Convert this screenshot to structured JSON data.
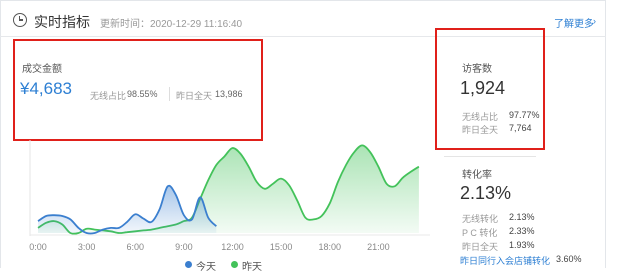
{
  "header": {
    "title": "实时指标",
    "update_time": "更新时间：2020-12-29 11:16:40",
    "more_link": "了解更多"
  },
  "sales": {
    "label": "成交金额",
    "value": "¥4,683",
    "wireless_label": "无线占比",
    "wireless_value": "98.55%",
    "yesterday_label": "昨日全天",
    "yesterday_value": "13,986"
  },
  "visitors": {
    "label": "访客数",
    "value": "1,924",
    "wireless_label": "无线占比",
    "wireless_value": "97.77%",
    "yesterday_label": "昨日全天",
    "yesterday_value": "7,764"
  },
  "conversion": {
    "label": "转化率",
    "value": "2.13%",
    "wireless_label": "无线转化",
    "wireless_value": "2.13%",
    "pc_label": "P C 转化",
    "pc_value": "2.33%",
    "yesterday_label": "昨日全天",
    "yesterday_value": "1.93%",
    "peer_label": "昨日同行入会店铺转化",
    "peer_value": "3.60%"
  },
  "colors": {
    "accent": "#2d7fd3",
    "highlight_box": "#e0201a",
    "today_line": "#3b7fcf",
    "yesterday_line": "#43c25a"
  },
  "chart_data": {
    "type": "area",
    "x_ticks": [
      "0:00",
      "3:00",
      "6:00",
      "9:00",
      "12:00",
      "15:00",
      "18:00",
      "21:00"
    ],
    "xlim": [
      0,
      24
    ],
    "y_axis_visible": false,
    "legend_position": "bottom-center",
    "series": [
      {
        "name": "今天",
        "color": "#3b7fcf",
        "x": [
          0,
          0.5,
          1,
          1.5,
          2,
          2.5,
          3,
          3.5,
          4,
          4.5,
          5,
          5.5,
          6,
          6.5,
          7,
          7.5,
          8,
          8.5,
          9,
          9.5,
          10,
          10.5,
          11
        ],
        "values": [
          0.14,
          0.2,
          0.21,
          0.2,
          0.16,
          0.06,
          0.0,
          0.0,
          0.04,
          0.06,
          0.06,
          0.13,
          0.22,
          0.17,
          0.13,
          0.28,
          0.55,
          0.45,
          0.21,
          0.16,
          0.42,
          0.18,
          0.08
        ]
      },
      {
        "name": "昨天",
        "color": "#43c25a",
        "x": [
          0,
          0.5,
          1,
          1.5,
          2,
          2.5,
          3,
          3.5,
          4,
          4.5,
          5,
          5.5,
          6,
          6.5,
          7,
          7.5,
          8,
          8.5,
          9,
          9.5,
          10,
          10.5,
          11,
          11.5,
          12,
          12.5,
          13,
          13.5,
          14,
          14.5,
          15,
          15.5,
          16,
          16.5,
          17,
          17.5,
          18,
          18.5,
          19,
          19.5,
          20,
          20.5,
          21,
          21.5,
          22,
          22.5,
          23,
          23.5
        ],
        "values": [
          0.06,
          0.12,
          0.14,
          0.1,
          0.0,
          0.0,
          0.05,
          0.04,
          0.03,
          0.02,
          0.0,
          0.01,
          0.02,
          0.03,
          0.04,
          0.06,
          0.08,
          0.1,
          0.14,
          0.18,
          0.4,
          0.62,
          0.8,
          0.9,
          1.0,
          0.93,
          0.78,
          0.6,
          0.52,
          0.58,
          0.64,
          0.56,
          0.38,
          0.18,
          0.16,
          0.2,
          0.35,
          0.6,
          0.8,
          0.95,
          1.03,
          0.95,
          0.78,
          0.58,
          0.55,
          0.65,
          0.72,
          0.78
        ]
      }
    ]
  }
}
